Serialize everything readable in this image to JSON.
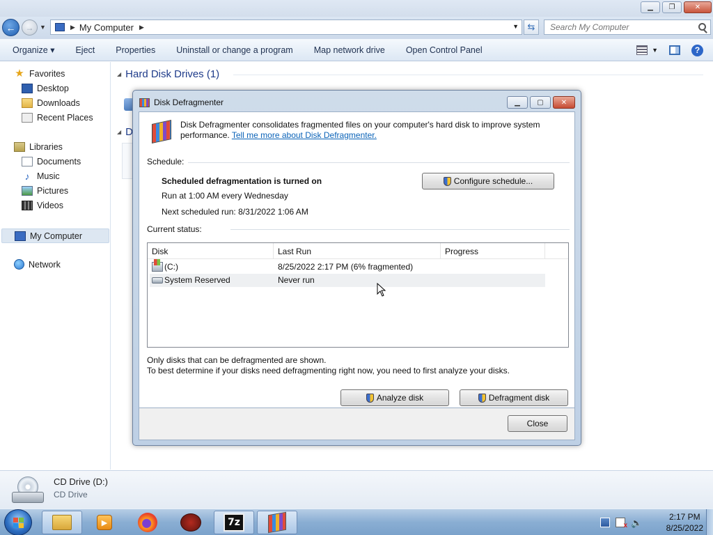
{
  "explorer": {
    "address": {
      "location": "My Computer"
    },
    "search": {
      "placeholder": "Search My Computer"
    },
    "toolbar": {
      "items": [
        "Organize ▾",
        "Eject",
        "Properties",
        "Uninstall or change a program",
        "Map network drive",
        "Open Control Panel"
      ]
    },
    "nav": {
      "favorites": "Favorites",
      "desktop": "Desktop",
      "downloads": "Downloads",
      "recent_places": "Recent Places",
      "libraries": "Libraries",
      "documents": "Documents",
      "music": "Music",
      "pictures": "Pictures",
      "videos": "Videos",
      "my_computer": "My Computer",
      "network": "Network"
    },
    "content": {
      "group_hard_disk": "Hard Disk Drives (1)",
      "group_d_partial": "D"
    },
    "details": {
      "name": "CD Drive (D:)",
      "type": "CD Drive"
    }
  },
  "dialog": {
    "title": "Disk Defragmenter",
    "intro_text": "Disk Defragmenter consolidates fragmented files on your computer's hard disk to improve system performance.",
    "intro_link": "Tell me more about Disk Defragmenter.",
    "schedule_label": "Schedule:",
    "schedule_status": "Scheduled defragmentation is turned on",
    "schedule_run": "Run at 1:00 AM every Wednesday",
    "schedule_next": "Next scheduled run: 8/31/2022 1:06 AM",
    "configure_button": "Configure schedule...",
    "current_status_label": "Current status:",
    "table": {
      "headers": {
        "disk": "Disk",
        "last_run": "Last Run",
        "progress": "Progress"
      },
      "rows": [
        {
          "disk": "(C:)",
          "last_run": "8/25/2022 2:17 PM (6% fragmented)",
          "progress": ""
        },
        {
          "disk": "System Reserved",
          "last_run": "Never run",
          "progress": ""
        }
      ]
    },
    "note1": "Only disks that can be defragmented are shown.",
    "note2": "To best determine if your disks need defragmenting right now, you need to first analyze your disks.",
    "analyze_button": "Analyze disk",
    "defragment_button": "Defragment disk",
    "close_button": "Close"
  },
  "taskbar": {
    "clock_time": "2:17 PM",
    "clock_date": "8/25/2022",
    "sevenzip_label": "7z"
  }
}
